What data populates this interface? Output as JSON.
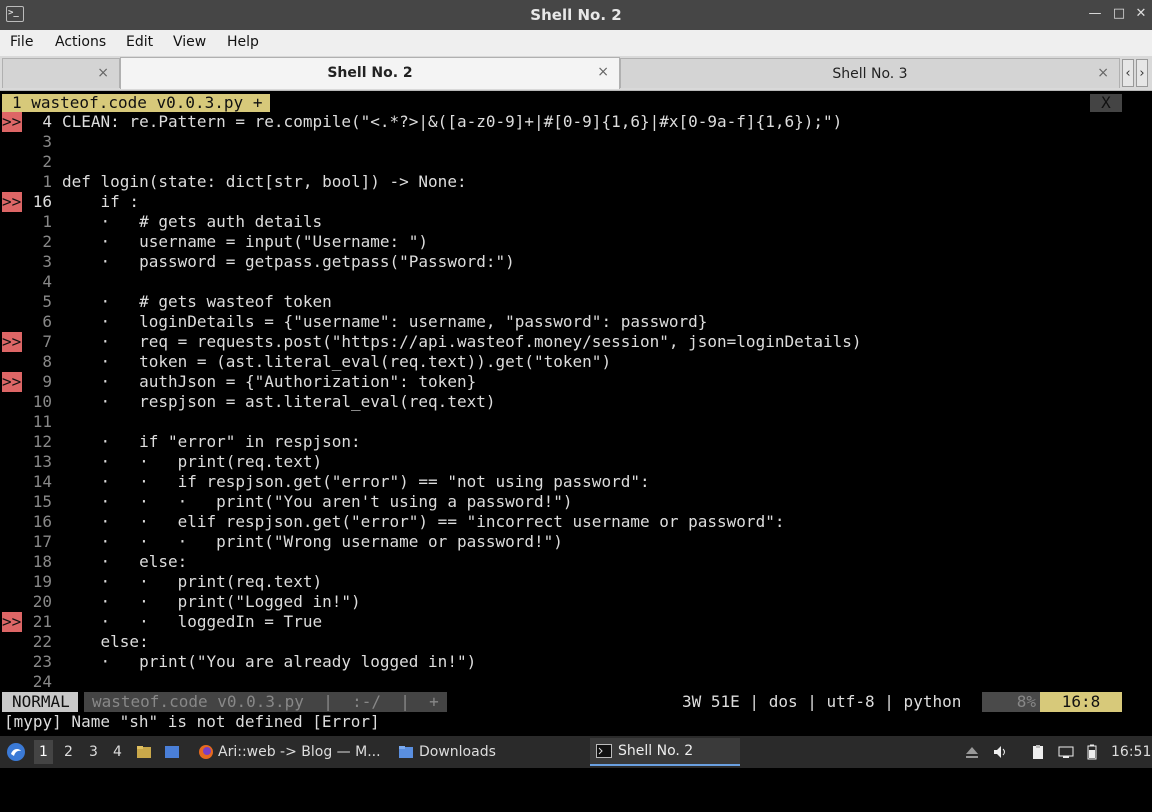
{
  "window": {
    "title": "Shell No. 2",
    "icon": "terminal-icon",
    "controls": [
      "minimize-icon",
      "maximize-icon",
      "close-icon"
    ]
  },
  "menu": {
    "file": "File",
    "actions": "Actions",
    "edit": "Edit",
    "view": "View",
    "help": "Help"
  },
  "tabs": [
    {
      "label": "",
      "close": "×"
    },
    {
      "label": "Shell No. 2",
      "close": "×"
    },
    {
      "label": "Shell No. 3",
      "close": "×"
    }
  ],
  "tab_scroll": {
    "left": "‹",
    "right": "›"
  },
  "editor": {
    "buffer_tab": "1 wasteof.code v0.0.3.py +",
    "buffer_close": "X",
    "lines": [
      {
        "num": "4",
        "sign": ">>",
        "code": "CLEAN: re.Pattern = re.compile(\"<.*?>|&([a-z0-9]+|#[0-9]{1,6}|#x[0-9a-f]{1,6});\")"
      },
      {
        "num": "3",
        "sign": "",
        "code": ""
      },
      {
        "num": "2",
        "sign": "",
        "code": ""
      },
      {
        "num": "1",
        "sign": "",
        "code": "def login(state: dict[str, bool]) -> None:"
      },
      {
        "num": "16",
        "sign": ">>",
        "code": "    if :"
      },
      {
        "num": "1",
        "sign": "",
        "code": "    ·   # gets auth details"
      },
      {
        "num": "2",
        "sign": "",
        "code": "    ·   username = input(\"Username: \")"
      },
      {
        "num": "3",
        "sign": "",
        "code": "    ·   password = getpass.getpass(\"Password:\")"
      },
      {
        "num": "4",
        "sign": "",
        "code": ""
      },
      {
        "num": "5",
        "sign": "",
        "code": "    ·   # gets wasteof token"
      },
      {
        "num": "6",
        "sign": "",
        "code": "    ·   loginDetails = {\"username\": username, \"password\": password}"
      },
      {
        "num": "7",
        "sign": ">>",
        "code": "    ·   req = requests.post(\"https://api.wasteof.money/session\", json=loginDetails)"
      },
      {
        "num": "8",
        "sign": "",
        "code": "    ·   token = (ast.literal_eval(req.text)).get(\"token\")"
      },
      {
        "num": "9",
        "sign": ">>",
        "code": "    ·   authJson = {\"Authorization\": token}"
      },
      {
        "num": "10",
        "sign": "",
        "code": "    ·   respjson = ast.literal_eval(req.text)"
      },
      {
        "num": "11",
        "sign": "",
        "code": ""
      },
      {
        "num": "12",
        "sign": "",
        "code": "    ·   if \"error\" in respjson:"
      },
      {
        "num": "13",
        "sign": "",
        "code": "    ·   ·   print(req.text)"
      },
      {
        "num": "14",
        "sign": "",
        "code": "    ·   ·   if respjson.get(\"error\") == \"not using password\":"
      },
      {
        "num": "15",
        "sign": "",
        "code": "    ·   ·   ·   print(\"You aren't using a password!\")"
      },
      {
        "num": "16",
        "sign": "",
        "code": "    ·   ·   elif respjson.get(\"error\") == \"incorrect username or password\":"
      },
      {
        "num": "17",
        "sign": "",
        "code": "    ·   ·   ·   print(\"Wrong username or password!\")"
      },
      {
        "num": "18",
        "sign": "",
        "code": "    ·   else:"
      },
      {
        "num": "19",
        "sign": "",
        "code": "    ·   ·   print(req.text)"
      },
      {
        "num": "20",
        "sign": "",
        "code": "    ·   ·   print(\"Logged in!\")"
      },
      {
        "num": "21",
        "sign": ">>",
        "code": "    ·   ·   loggedIn = True"
      },
      {
        "num": "22",
        "sign": "",
        "code": "    else:"
      },
      {
        "num": "23",
        "sign": "",
        "code": "    ·   print(\"You are already logged in!\")"
      },
      {
        "num": "24",
        "sign": "",
        "code": ""
      }
    ]
  },
  "statusline": {
    "mode": "NORMAL",
    "file": "wasteof.code v0.0.3.py  |  :-/  |  +",
    "info": "3W 51E | dos | utf-8 | python",
    "percent": "8%",
    "position": "16:8"
  },
  "message": "[mypy] Name \"sh\" is not defined [Error]",
  "taskbar": {
    "workspaces": [
      "1",
      "2",
      "3",
      "4"
    ],
    "firefox_task": "Ari::web -> Blog — M...",
    "downloads_task": "Downloads",
    "shell_task": "Shell No. 2",
    "clock": "16:51"
  }
}
